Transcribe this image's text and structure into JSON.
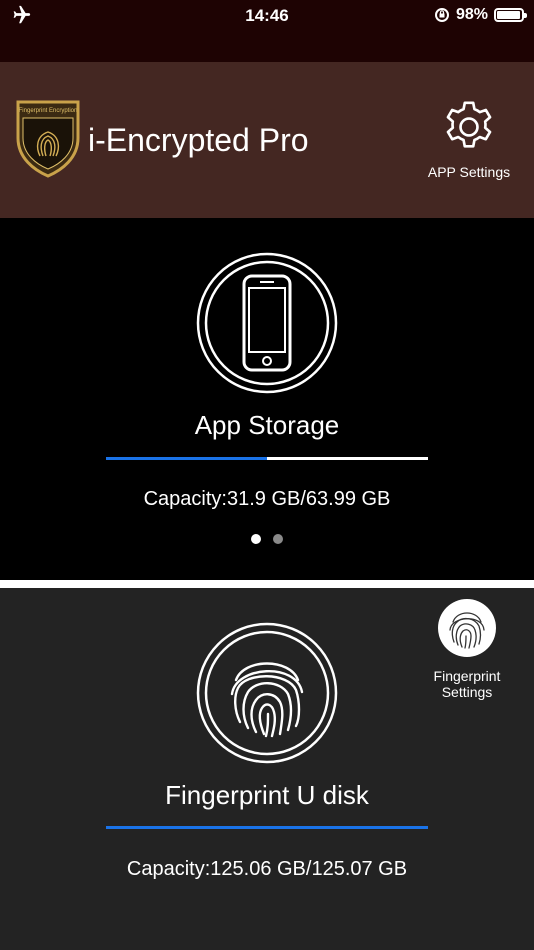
{
  "status_bar": {
    "airplane_icon": "airplane-icon",
    "time": "14:46",
    "rotation_lock_icon": "rotation-lock-icon",
    "battery_percent": "98%",
    "battery_level": 0.98
  },
  "header": {
    "logo_text": "Fingerprint Encryption",
    "title": "i-Encrypted Pro",
    "settings_icon": "gear-icon",
    "settings_label": "APP Settings",
    "background_color": "#442722"
  },
  "storage_card": {
    "icon": "smartphone-icon",
    "title": "App Storage",
    "usage_fraction": 0.5,
    "capacity_text": "Capacity:31.9 GB/63.99 GB",
    "page_count": 2,
    "active_page": 0
  },
  "udisk_card": {
    "icon": "fingerprint-icon",
    "title": "Fingerprint U disk",
    "usage_fraction": 0.9999,
    "capacity_text": "Capacity:125.06 GB/125.07 GB",
    "settings_icon": "fingerprint-icon",
    "settings_label_line1": "Fingerprint",
    "settings_label_line2": "Settings"
  },
  "colors": {
    "accent": "#1a73e8",
    "status_bar": "#1e0303",
    "lower_panel": "#232323"
  }
}
